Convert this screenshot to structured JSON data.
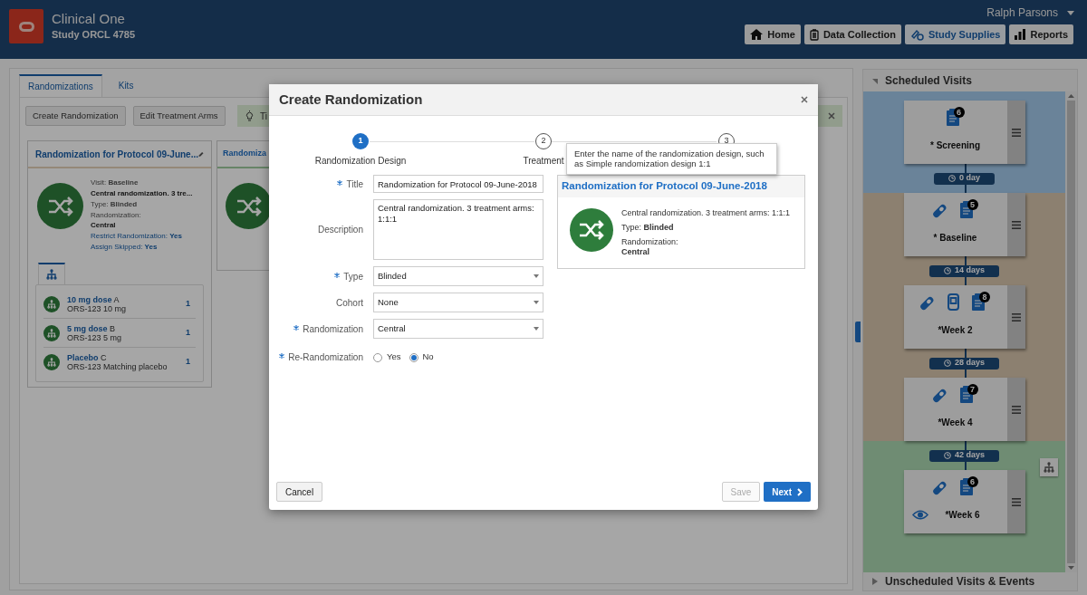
{
  "app": {
    "title": "Clinical One",
    "study": "Study ORCL 4785",
    "user": "Ralph Parsons"
  },
  "nav": [
    {
      "label": "Home",
      "selected": false
    },
    {
      "label": "Data Collection",
      "selected": false
    },
    {
      "label": "Study Supplies",
      "selected": true
    },
    {
      "label": "Reports",
      "selected": false
    }
  ],
  "tabs": [
    {
      "label": "Randomizations",
      "selected": true
    },
    {
      "label": "Kits",
      "selected": false
    }
  ],
  "toolbar": {
    "buttons": [
      "Create Randomization",
      "Edit Treatment Arms"
    ],
    "tip": "Ti"
  },
  "cards": [
    {
      "title": "Randomization for Protocol 09-June...",
      "lines": [
        {
          "kind": "plain",
          "text": "Visit: **Baseline**"
        },
        {
          "kind": "bold",
          "text": "Central randomization. 3 tre..."
        },
        {
          "kind": "plain",
          "text": "Type: **Blinded**"
        },
        {
          "kind": "stack",
          "label": "Randomization:",
          "value": "Central"
        },
        {
          "kind": "link",
          "text": "Restrict Randomization: **Yes**"
        },
        {
          "kind": "link",
          "text": "Assign Skipped: **Yes**"
        }
      ],
      "arms": [
        {
          "name": "10 mg dose",
          "code": "A",
          "kit": "ORS-123 10 mg",
          "count": "1"
        },
        {
          "name": "5 mg dose",
          "code": "B",
          "kit": "ORS-123 5 mg",
          "count": "1"
        },
        {
          "name": "Placebo",
          "code": "C",
          "kit": "ORS-123 Matching placebo",
          "count": "1"
        }
      ]
    },
    {
      "title": "Randomiza"
    }
  ],
  "dialog": {
    "title": "Create Randomization",
    "steps": [
      {
        "number": "1",
        "label": "Randomization Design",
        "selected": true
      },
      {
        "number": "2",
        "label": "Treatment",
        "selected": false
      },
      {
        "number": "3",
        "selected": false
      }
    ],
    "tooltip": "Enter the name of the randomization design, such as Simple randomization design 1:1",
    "fields": [
      {
        "kind": "input",
        "label": "Title",
        "required": true,
        "value": "Randomization for Protocol 09-June-2018"
      },
      {
        "kind": "textarea",
        "label": "Description",
        "required": false,
        "value": "Central randomization. 3 treatment arms: 1:1:1"
      },
      {
        "kind": "select",
        "label": "Type",
        "required": true,
        "value": "Blinded"
      },
      {
        "kind": "select",
        "label": "Cohort",
        "required": false,
        "value": "None"
      },
      {
        "kind": "select",
        "label": "Randomization",
        "required": true,
        "value": "Central"
      },
      {
        "kind": "radio",
        "label": "Re-Randomization",
        "required": true,
        "options": [
          {
            "label": "Yes",
            "selected": false
          },
          {
            "label": "No",
            "selected": true
          }
        ]
      }
    ],
    "preview": {
      "title": "Randomization for Protocol 09-June-2018",
      "description": "Central randomization. 3 treatment arms: 1:1:1",
      "type": "Type: **Blinded**",
      "randomization_label": "Randomization:",
      "randomization": "Central"
    },
    "buttons": [
      {
        "label": "Cancel",
        "kind": "secondary",
        "disabled": false
      },
      {
        "label": "Save",
        "kind": "secondary",
        "disabled": true
      },
      {
        "label": "Next",
        "kind": "primary",
        "disabled": false
      }
    ]
  },
  "schedule": {
    "title": "Scheduled Visits",
    "footer": "Unscheduled Visits & Events",
    "items": [
      {
        "kind": "visit",
        "name": "* Screening",
        "icons": [
          {
            "kind": "form",
            "badge": "6"
          }
        ],
        "color": "#6a8399"
      },
      {
        "kind": "interval",
        "label": "0 day",
        "color": "#6a8399"
      },
      {
        "kind": "visit",
        "name": "* Baseline",
        "icons": [
          {
            "kind": "pill"
          },
          {
            "kind": "form",
            "badge": "5"
          }
        ],
        "color": "#8c8070"
      },
      {
        "kind": "interval",
        "label": "14 days",
        "color": "#8c8070"
      },
      {
        "kind": "visit",
        "name": "*Week 2",
        "icons": [
          {
            "kind": "pill"
          },
          {
            "kind": "device"
          },
          {
            "kind": "form",
            "badge": "8"
          }
        ],
        "color": "#8c8070"
      },
      {
        "kind": "interval",
        "label": "28 days",
        "color": "#8c8070"
      },
      {
        "kind": "visit",
        "name": "*Week 4",
        "icons": [
          {
            "kind": "pill"
          },
          {
            "kind": "form",
            "badge": "7"
          }
        ],
        "color": "#8c8070"
      },
      {
        "kind": "interval",
        "label": "42 days",
        "color": "#6f8c73"
      },
      {
        "kind": "visit",
        "name": "*Week 6",
        "icons": [
          {
            "kind": "pill"
          },
          {
            "kind": "form",
            "badge": "6"
          }
        ],
        "eye": true,
        "color": "#6f8c73"
      }
    ]
  }
}
